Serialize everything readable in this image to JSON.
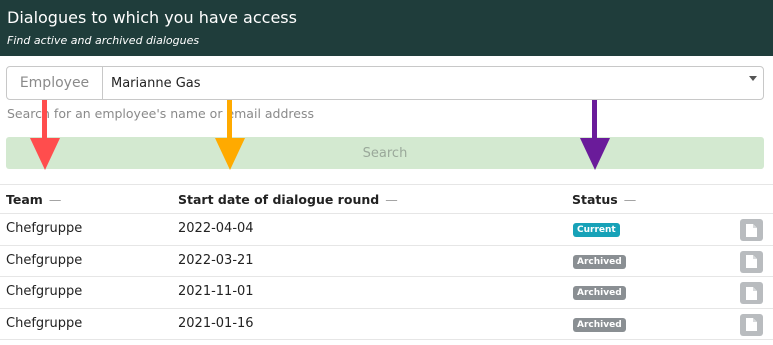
{
  "header": {
    "title": "Dialogues to which you have access",
    "subtitle": "Find active and archived dialogues"
  },
  "employee_filter": {
    "addon_label": "Employee",
    "selected_value": "Marianne Gas",
    "help_text": "Search for an employee's name or email address"
  },
  "search_button": {
    "label": "Search"
  },
  "table": {
    "columns": [
      {
        "label": "Team",
        "sort_indicator": "—"
      },
      {
        "label": "Start date of dialogue round",
        "sort_indicator": "—"
      },
      {
        "label": "Status",
        "sort_indicator": "—"
      }
    ],
    "rows": [
      {
        "team": "Chefgruppe",
        "start_date": "2022-04-04",
        "status": "Current",
        "status_color": "#17a2b8"
      },
      {
        "team": "Chefgruppe",
        "start_date": "2022-03-21",
        "status": "Archived",
        "status_color": "#8a8f93"
      },
      {
        "team": "Chefgruppe",
        "start_date": "2021-11-01",
        "status": "Archived",
        "status_color": "#8a8f93"
      },
      {
        "team": "Chefgruppe",
        "start_date": "2021-01-16",
        "status": "Archived",
        "status_color": "#8a8f93"
      }
    ]
  },
  "annotations": {
    "arrow_colors": [
      "#ff4d4d",
      "#ffaa00",
      "#6a1b9a"
    ],
    "icon": "document-icon"
  },
  "colors": {
    "header_bg": "#1f3d3b",
    "search_bg": "#d3e9d0"
  }
}
